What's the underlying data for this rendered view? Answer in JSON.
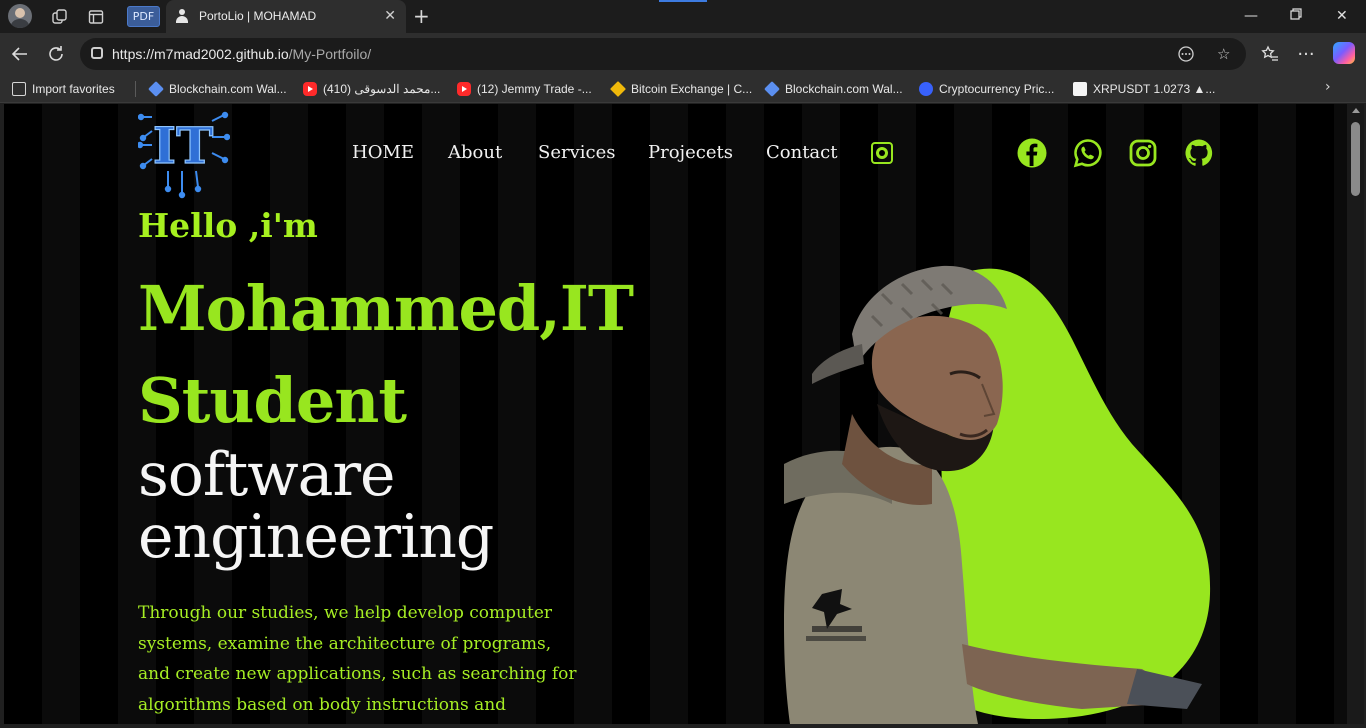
{
  "browser": {
    "pdf_tab_label": "PDF",
    "active_tab_title": "PortoLio | MOHAMAD",
    "url_host": "https://m7mad2002.github.io",
    "url_path": "/My-Portfoilo/",
    "favorites": [
      {
        "label": "Import favorites",
        "icon": "folder-icon"
      },
      {
        "label": "Blockchain.com Wal...",
        "icon": "blockchain-icon"
      },
      {
        "label": "محمد الدسوقى (410)...",
        "icon": "youtube-icon"
      },
      {
        "label": "(12) Jemmy Trade -...",
        "icon": "youtube-icon"
      },
      {
        "label": "Bitcoin Exchange | C...",
        "icon": "binance-icon"
      },
      {
        "label": "Blockchain.com Wal...",
        "icon": "blockchain-icon"
      },
      {
        "label": "Cryptocurrency Pric...",
        "icon": "coinmarketcap-icon"
      },
      {
        "label": "XRPUSDT 1.0273 ▲...",
        "icon": "tradingview-icon"
      }
    ]
  },
  "site": {
    "logo_text": "IT",
    "nav": [
      "HOME",
      "About",
      "Services",
      "Projecets",
      "Contact"
    ],
    "social": [
      "facebook-icon",
      "whatsapp-icon",
      "instagram-icon",
      "github-icon"
    ],
    "hero": {
      "greeting": "Hello ,i'm",
      "name": "Mohammed,IT",
      "role": "Student",
      "field_line1": "software",
      "field_line2": "engineering",
      "description": "Through our studies, we help develop computer systems, examine the architecture of programs, and create new applications, such as searching for algorithms based on body instructions and"
    },
    "colors": {
      "accent": "#98e61f",
      "background": "#000000",
      "text": "#f5f5f5"
    }
  }
}
